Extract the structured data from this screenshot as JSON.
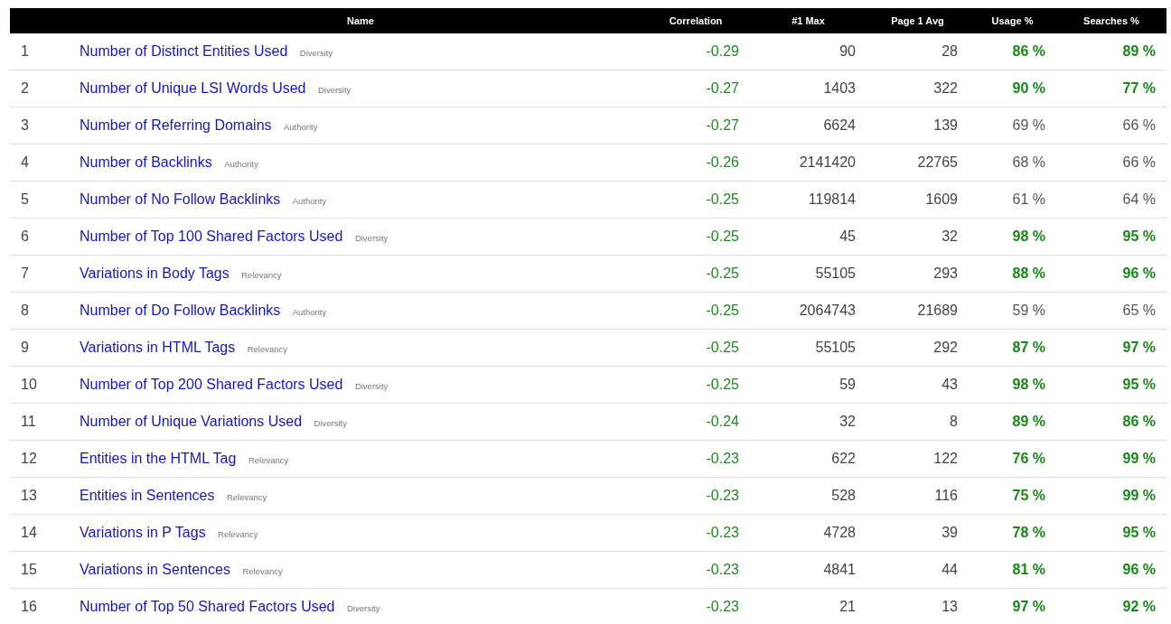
{
  "table": {
    "columns": [
      "Name",
      "Correlation",
      "#1 Max",
      "Page 1 Avg",
      "Usage %",
      "Searches %"
    ],
    "rows": [
      {
        "rank": "1",
        "name": "Number of Distinct Entities Used",
        "tag": "Diversity",
        "correlation": "-0.29",
        "max": "90",
        "avg": "28",
        "usage": {
          "value": "86 %",
          "good": true
        },
        "searches": {
          "value": "89 %",
          "good": true
        }
      },
      {
        "rank": "2",
        "name": "Number of Unique LSI Words Used",
        "tag": "Diversity",
        "correlation": "-0.27",
        "max": "1403",
        "avg": "322",
        "usage": {
          "value": "90 %",
          "good": true
        },
        "searches": {
          "value": "77 %",
          "good": true
        }
      },
      {
        "rank": "3",
        "name": "Number of Referring Domains",
        "tag": "Authority",
        "correlation": "-0.27",
        "max": "6624",
        "avg": "139",
        "usage": {
          "value": "69 %",
          "good": false
        },
        "searches": {
          "value": "66 %",
          "good": false
        }
      },
      {
        "rank": "4",
        "name": "Number of Backlinks",
        "tag": "Authority",
        "correlation": "-0.26",
        "max": "2141420",
        "avg": "22765",
        "usage": {
          "value": "68 %",
          "good": false
        },
        "searches": {
          "value": "66 %",
          "good": false
        }
      },
      {
        "rank": "5",
        "name": "Number of No Follow Backlinks",
        "tag": "Authority",
        "correlation": "-0.25",
        "max": "119814",
        "avg": "1609",
        "usage": {
          "value": "61 %",
          "good": false
        },
        "searches": {
          "value": "64 %",
          "good": false
        }
      },
      {
        "rank": "6",
        "name": "Number of Top 100 Shared Factors Used",
        "tag": "Diversity",
        "correlation": "-0.25",
        "max": "45",
        "avg": "32",
        "usage": {
          "value": "98 %",
          "good": true
        },
        "searches": {
          "value": "95 %",
          "good": true
        }
      },
      {
        "rank": "7",
        "name": "Variations in Body Tags",
        "tag": "Relevancy",
        "correlation": "-0.25",
        "max": "55105",
        "avg": "293",
        "usage": {
          "value": "88 %",
          "good": true
        },
        "searches": {
          "value": "96 %",
          "good": true
        }
      },
      {
        "rank": "8",
        "name": "Number of Do Follow Backlinks",
        "tag": "Authority",
        "correlation": "-0.25",
        "max": "2064743",
        "avg": "21689",
        "usage": {
          "value": "59 %",
          "good": false
        },
        "searches": {
          "value": "65 %",
          "good": false
        }
      },
      {
        "rank": "9",
        "name": "Variations in HTML Tags",
        "tag": "Relevancy",
        "correlation": "-0.25",
        "max": "55105",
        "avg": "292",
        "usage": {
          "value": "87 %",
          "good": true
        },
        "searches": {
          "value": "97 %",
          "good": true
        }
      },
      {
        "rank": "10",
        "name": "Number of Top 200 Shared Factors Used",
        "tag": "Diversity",
        "correlation": "-0.25",
        "max": "59",
        "avg": "43",
        "usage": {
          "value": "98 %",
          "good": true
        },
        "searches": {
          "value": "95 %",
          "good": true
        }
      },
      {
        "rank": "11",
        "name": "Number of Unique Variations Used",
        "tag": "Diversity",
        "correlation": "-0.24",
        "max": "32",
        "avg": "8",
        "usage": {
          "value": "89 %",
          "good": true
        },
        "searches": {
          "value": "86 %",
          "good": true
        }
      },
      {
        "rank": "12",
        "name": "Entities in the HTML Tag",
        "tag": "Relevancy",
        "correlation": "-0.23",
        "max": "622",
        "avg": "122",
        "usage": {
          "value": "76 %",
          "good": true
        },
        "searches": {
          "value": "99 %",
          "good": true
        }
      },
      {
        "rank": "13",
        "name": "Entities in Sentences",
        "tag": "Relevancy",
        "correlation": "-0.23",
        "max": "528",
        "avg": "116",
        "usage": {
          "value": "75 %",
          "good": true
        },
        "searches": {
          "value": "99 %",
          "good": true
        }
      },
      {
        "rank": "14",
        "name": "Variations in P Tags",
        "tag": "Relevancy",
        "correlation": "-0.23",
        "max": "4728",
        "avg": "39",
        "usage": {
          "value": "78 %",
          "good": true
        },
        "searches": {
          "value": "95 %",
          "good": true
        }
      },
      {
        "rank": "15",
        "name": "Variations in Sentences",
        "tag": "Relevancy",
        "correlation": "-0.23",
        "max": "4841",
        "avg": "44",
        "usage": {
          "value": "81 %",
          "good": true
        },
        "searches": {
          "value": "96 %",
          "good": true
        }
      },
      {
        "rank": "16",
        "name": "Number of Top 50 Shared Factors Used",
        "tag": "Diversity",
        "correlation": "-0.23",
        "max": "21",
        "avg": "13",
        "usage": {
          "value": "97 %",
          "good": true
        },
        "searches": {
          "value": "92 %",
          "good": true
        }
      }
    ]
  }
}
